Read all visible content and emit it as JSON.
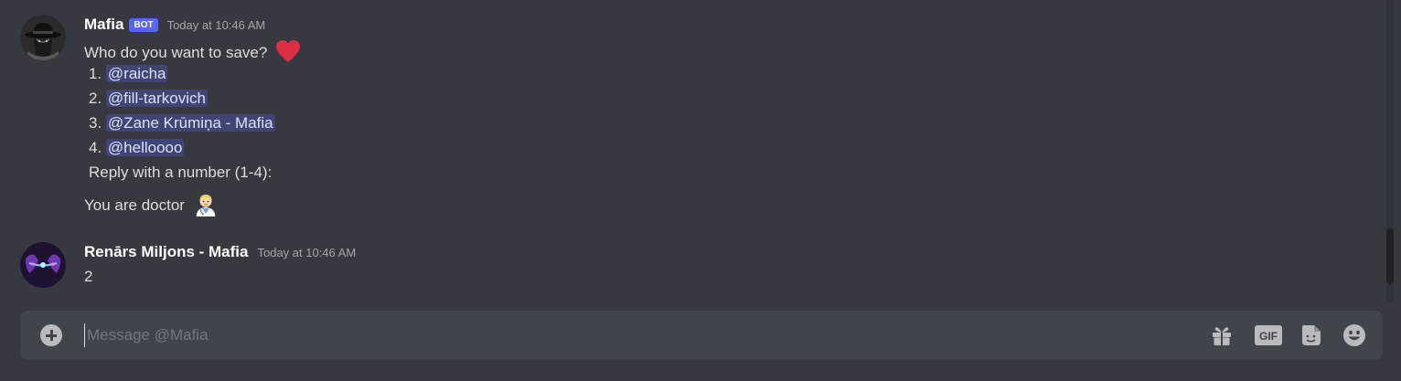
{
  "messages": [
    {
      "username": "Mafia",
      "bot_tag": "BOT",
      "timestamp": "Today at 10:46 AM",
      "avatar_icon": "mafia-hat-avatar",
      "prompt": "Who do you want to save?",
      "options": [
        {
          "num": "1.",
          "mention": "@raicha"
        },
        {
          "num": "2.",
          "mention": "@fill-tarkovich"
        },
        {
          "num": "3.",
          "mention": "@Zane Krūmiņa - Mafia"
        },
        {
          "num": "4.",
          "mention": "@helloooo"
        }
      ],
      "reply_instruction": "Reply with a number (1-4):",
      "role_text": "You are doctor"
    },
    {
      "username": "Renārs Miljons - Mafia",
      "timestamp": "Today at 10:46 AM",
      "avatar_icon": "abstract-purple-avatar",
      "content": "2"
    }
  ],
  "composer": {
    "placeholder": "Message @Mafia",
    "tools": [
      "gift-icon",
      "gif-icon",
      "sticker-icon",
      "emoji-icon"
    ]
  },
  "colors": {
    "background": "#36393f",
    "composer": "#40444b",
    "bot_tag": "#5865f2",
    "mention_bg": "rgba(88,101,242,0.3)",
    "heart": "#dd2e44"
  }
}
